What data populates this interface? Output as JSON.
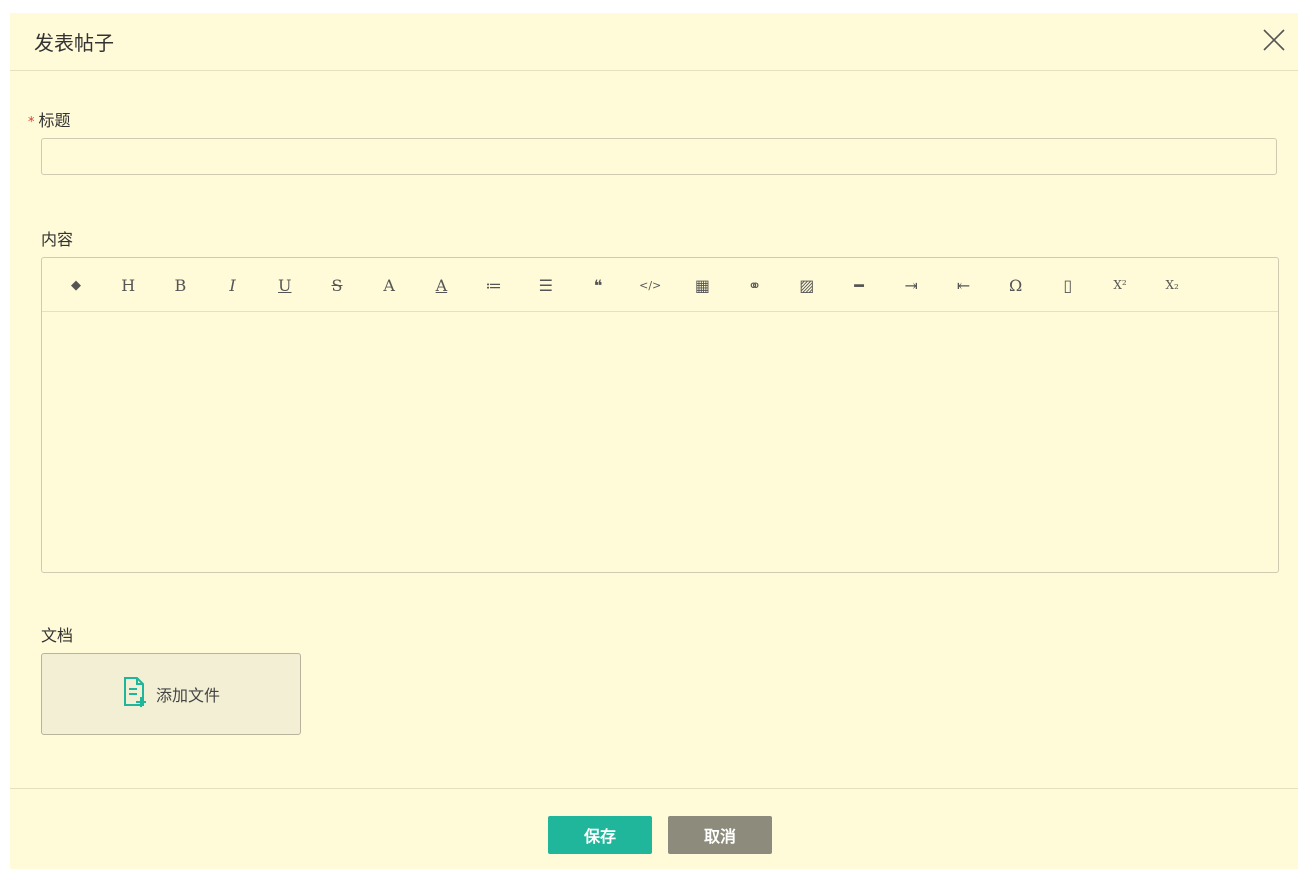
{
  "dialog": {
    "title": "发表帖子"
  },
  "form": {
    "title_label": "标题",
    "required_mark": "*",
    "title_value": "",
    "content_label": "内容",
    "doc_label": "文档",
    "add_file_label": "添加文件"
  },
  "toolbar": {
    "buttons": [
      {
        "name": "eraser-icon",
        "glyph": "◆"
      },
      {
        "name": "heading-icon",
        "glyph": "H"
      },
      {
        "name": "bold-icon",
        "glyph": "B"
      },
      {
        "name": "italic-icon",
        "glyph": "I"
      },
      {
        "name": "underline-icon",
        "glyph": "U"
      },
      {
        "name": "strikethrough-icon",
        "glyph": "S"
      },
      {
        "name": "font-color-icon",
        "glyph": "A"
      },
      {
        "name": "background-color-icon",
        "glyph": "A"
      },
      {
        "name": "ordered-list-icon",
        "glyph": "≔"
      },
      {
        "name": "unordered-list-icon",
        "glyph": "☰"
      },
      {
        "name": "blockquote-icon",
        "glyph": "❝"
      },
      {
        "name": "code-icon",
        "glyph": "</>"
      },
      {
        "name": "table-icon",
        "glyph": "▦"
      },
      {
        "name": "link-icon",
        "glyph": "⚭"
      },
      {
        "name": "image-icon",
        "glyph": "▨"
      },
      {
        "name": "horizontal-rule-icon",
        "glyph": "━"
      },
      {
        "name": "indent-icon",
        "glyph": "⇥"
      },
      {
        "name": "outdent-icon",
        "glyph": "⇤"
      },
      {
        "name": "special-char-icon",
        "glyph": "Ω"
      },
      {
        "name": "pdf-icon",
        "glyph": "▯"
      },
      {
        "name": "superscript-icon",
        "glyph": "X²"
      },
      {
        "name": "subscript-icon",
        "glyph": "X₂"
      }
    ]
  },
  "footer": {
    "save_label": "保存",
    "cancel_label": "取消"
  },
  "colors": {
    "background": "#fffad7",
    "primary": "#1fb69b",
    "secondary": "#8d8b7b",
    "required": "#e4393c"
  }
}
